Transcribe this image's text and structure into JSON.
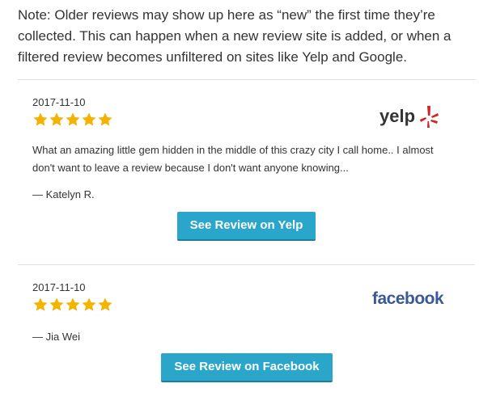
{
  "note": "Note: Older reviews may show up here as “new” the first time they’re collected. This can happen when a new review site is added, or when a filtered review becomes unfiltered on sites like Yelp and Google.",
  "colors": {
    "star": "#f5b300",
    "button": "#2ba6cb",
    "facebook": "#3b5998",
    "yelp_burst": "#d32323"
  },
  "reviews": [
    {
      "date": "2017-11-10",
      "rating": 5,
      "site_logo_text": "yelp",
      "site_logo_icon": "yelp-burst-icon",
      "text": "What an amazing little gem hidden in the middle of this crazy city I call home.. I almost don't want to leave a review because I don't want anyone knowing...",
      "author": "— Katelyn R.",
      "button_label": "See Review on Yelp"
    },
    {
      "date": "2017-11-10",
      "rating": 5,
      "site_logo_text": "facebook",
      "text": "",
      "author": "— Jia Wei",
      "button_label": "See Review on Facebook"
    }
  ]
}
